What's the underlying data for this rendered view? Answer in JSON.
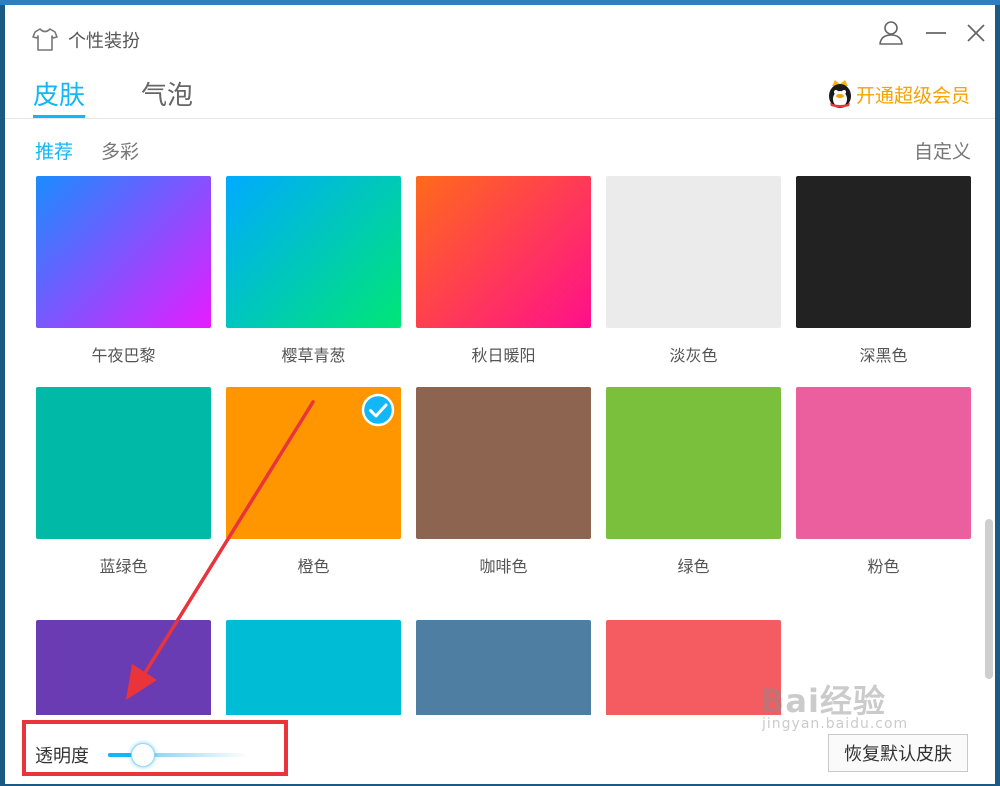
{
  "window": {
    "title": "个性装扮"
  },
  "tabs": [
    {
      "label": "皮肤",
      "active": true
    },
    {
      "label": "气泡",
      "active": false
    }
  ],
  "vip": {
    "label": "开通超级会员"
  },
  "subtabs": [
    {
      "label": "推荐",
      "active": true
    },
    {
      "label": "多彩",
      "active": false
    }
  ],
  "custom_label": "自定义",
  "skins": [
    {
      "name": "午夜巴黎",
      "colors": [
        "#1a8cff",
        "#e61cff"
      ],
      "selected": false
    },
    {
      "name": "樱草青葱",
      "colors": [
        "#00aaff",
        "#00e676"
      ],
      "selected": false
    },
    {
      "name": "秋日暖阳",
      "colors": [
        "#ff6a1a",
        "#ff0f8c"
      ],
      "selected": false
    },
    {
      "name": "淡灰色",
      "colors": [
        "#ebebeb"
      ],
      "selected": false
    },
    {
      "name": "深黑色",
      "colors": [
        "#222222"
      ],
      "selected": false
    },
    {
      "name": "蓝绿色",
      "colors": [
        "#00b9a6"
      ],
      "selected": false
    },
    {
      "name": "橙色",
      "colors": [
        "#ff9600"
      ],
      "selected": true
    },
    {
      "name": "咖啡色",
      "colors": [
        "#8c6450"
      ],
      "selected": false
    },
    {
      "name": "绿色",
      "colors": [
        "#7ac03c"
      ],
      "selected": false
    },
    {
      "name": "粉色",
      "colors": [
        "#ec5f9e"
      ],
      "selected": false
    },
    {
      "name": "",
      "colors": [
        "#6a3cb4"
      ],
      "selected": false
    },
    {
      "name": "",
      "colors": [
        "#00bcd4"
      ],
      "selected": false
    },
    {
      "name": "",
      "colors": [
        "#4f7ea3"
      ],
      "selected": false
    },
    {
      "name": "",
      "colors": [
        "#f45c62"
      ],
      "selected": false
    }
  ],
  "bottom": {
    "opacity_label": "透明度",
    "opacity_value": 0.2,
    "restore_label": "恢复默认皮肤"
  },
  "watermark": {
    "main": "Bai经验",
    "sub": "jingyan.baidu.com"
  },
  "accent_color": "#12b7f5",
  "vip_color": "#f5a300",
  "annotation_color": "#e8343a"
}
